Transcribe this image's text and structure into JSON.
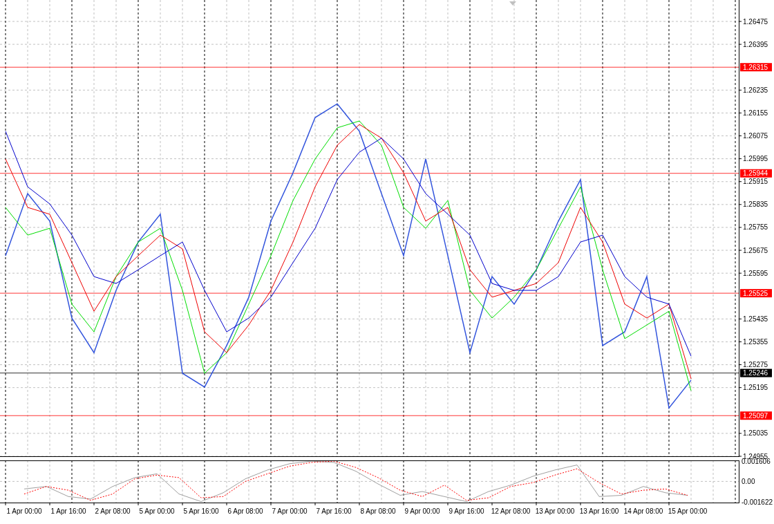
{
  "price_chart": {
    "chart_data": {
      "type": "line",
      "grid": true,
      "ylim": [
        1.24955,
        1.26475
      ],
      "yticks": [
        {
          "value": 1.26475,
          "label": "1.26475"
        },
        {
          "value": 1.26395,
          "label": "1.26395"
        },
        {
          "value": 1.26235,
          "label": "1.26235"
        },
        {
          "value": 1.26155,
          "label": "1.26155"
        },
        {
          "value": 1.26075,
          "label": "1.26075"
        },
        {
          "value": 1.25995,
          "label": "1.25995"
        },
        {
          "value": 1.25915,
          "label": "1.25915"
        },
        {
          "value": 1.25835,
          "label": "1.25835"
        },
        {
          "value": 1.25755,
          "label": "1.25755"
        },
        {
          "value": 1.25675,
          "label": "1.25675"
        },
        {
          "value": 1.25595,
          "label": "1.25595"
        },
        {
          "value": 1.25435,
          "label": "1.25435"
        },
        {
          "value": 1.25355,
          "label": "1.25355"
        },
        {
          "value": 1.25275,
          "label": "1.25275"
        },
        {
          "value": 1.25195,
          "label": "1.25195"
        },
        {
          "value": 1.25035,
          "label": "1.25035"
        },
        {
          "value": 1.24955,
          "label": "1.24955"
        }
      ],
      "series": [
        {
          "color": "#3355dd",
          "values": [
            1.25656,
            1.25873,
            1.25777,
            1.25438,
            1.25317,
            1.25535,
            1.25704,
            1.25801,
            1.25245,
            1.25197,
            1.25342,
            1.25511,
            1.25777,
            1.25946,
            1.26139,
            1.26187,
            1.26091,
            1.25873,
            1.25656,
            1.25994,
            1.25656,
            1.25317,
            1.25583,
            1.25487,
            1.25607,
            1.25777,
            1.25922,
            1.25342,
            1.2539,
            1.25583,
            1.25124,
            1.25221
          ]
        },
        {
          "color": "#00dd00",
          "values": [
            1.25825,
            1.25728,
            1.25752,
            1.25487,
            1.2539,
            1.25583,
            1.25704,
            1.25752,
            1.25535,
            1.25245,
            1.25317,
            1.25487,
            1.25656,
            1.25849,
            1.25994,
            1.26103,
            1.26127,
            1.26042,
            1.25825,
            1.25752,
            1.25849,
            1.25535,
            1.25438,
            1.25511,
            1.25607,
            1.25752,
            1.25897,
            1.25607,
            1.25366,
            1.25414,
            1.25462,
            1.25184
          ]
        },
        {
          "color": "#ee0000",
          "values": [
            1.25994,
            1.25825,
            1.25801,
            1.25632,
            1.25462,
            1.25583,
            1.25656,
            1.25728,
            1.2568,
            1.2539,
            1.25317,
            1.25414,
            1.25535,
            1.25704,
            1.25897,
            1.26042,
            1.26115,
            1.26067,
            1.25946,
            1.25777,
            1.25825,
            1.25607,
            1.25511,
            1.25535,
            1.25559,
            1.25632,
            1.25825,
            1.25704,
            1.25487,
            1.25438,
            1.25487,
            1.25226
          ]
        },
        {
          "color": "#0000cc",
          "values": [
            1.26091,
            1.25897,
            1.25837,
            1.25728,
            1.25583,
            1.25559,
            1.25607,
            1.25656,
            1.25704,
            1.25535,
            1.2539,
            1.25438,
            1.25511,
            1.25632,
            1.25752,
            1.25922,
            1.26018,
            1.26067,
            1.25994,
            1.25873,
            1.25801,
            1.25728,
            1.25559,
            1.25535,
            1.25535,
            1.25583,
            1.25704,
            1.25728,
            1.25583,
            1.25511,
            1.25487,
            1.25305
          ]
        }
      ],
      "ref_lines": [
        {
          "axis": "y",
          "value": 1.26315,
          "label": "1.26315",
          "color": "#ff0000"
        },
        {
          "axis": "y",
          "value": 1.25944,
          "label": "1.25944",
          "color": "#ff0000"
        },
        {
          "axis": "y",
          "value": 1.25525,
          "label": "1.25525",
          "color": "#ff0000"
        },
        {
          "axis": "y",
          "value": 1.25246,
          "label": "1.25246",
          "color": "#000000"
        },
        {
          "axis": "y",
          "value": 1.25097,
          "label": "1.25097",
          "color": "#ff0000"
        }
      ]
    }
  },
  "oscillator": {
    "chart_data": {
      "type": "line",
      "grid": true,
      "categories": [
        "1 Apr 00:00",
        null,
        "1 Apr 16:00",
        null,
        "2 Apr 08:00",
        null,
        "5 Apr 00:00",
        null,
        "5 Apr 16:00",
        null,
        "6 Apr 08:00",
        null,
        "7 Apr 00:00",
        null,
        "7 Apr 16:00",
        null,
        "8 Apr 08:00",
        null,
        "9 Apr 00:00",
        null,
        "9 Apr 16:00",
        null,
        "12 Apr 08:00",
        null,
        "13 Apr 00:00",
        null,
        "13 Apr 16:00",
        null,
        "14 Apr 08:00",
        null,
        "15 Apr 00:00"
      ],
      "ylim": [
        -0.001622,
        0.001606
      ],
      "yticks": [
        {
          "value": 0.001606,
          "label": "0.001606"
        },
        {
          "value": 0,
          "label": "0.00"
        },
        {
          "value": -0.001622,
          "label": "-0.001622"
        }
      ],
      "series": [
        {
          "color": "#a0a0a0",
          "line_style": "solid",
          "values": [
            -0.0006,
            -0.0004,
            -0.0012,
            -0.0014,
            -0.0004,
            0.0003,
            0.0006,
            -0.001,
            -0.0016,
            -0.0009,
            0.0002,
            0.0009,
            0.0014,
            0.0016,
            0.0015,
            0.0008,
            -0.0002,
            -0.0011,
            -0.0008,
            -0.0012,
            -0.0016,
            -0.0008,
            -0.0003,
            0.0004,
            0.0009,
            0.0013,
            -0.0012,
            -0.0011,
            -0.0004,
            -0.0009,
            -0.0011
          ]
        },
        {
          "color": "#ff0000",
          "line_style": "dashed",
          "values": [
            -0.001,
            -0.0004,
            -0.0007,
            -0.0015,
            -0.001,
            0.0002,
            0.0005,
            0.0003,
            -0.0013,
            -0.0012,
            0.0,
            0.0006,
            0.0012,
            0.0015,
            0.0016,
            0.0011,
            0.0003,
            -0.0007,
            -0.0012,
            -0.0003,
            -0.0015,
            -0.0013,
            -0.0004,
            -0.0001,
            0.0005,
            0.001,
            -0.0001,
            -0.001,
            -0.0007,
            -0.0006,
            -0.0011
          ]
        }
      ]
    }
  }
}
